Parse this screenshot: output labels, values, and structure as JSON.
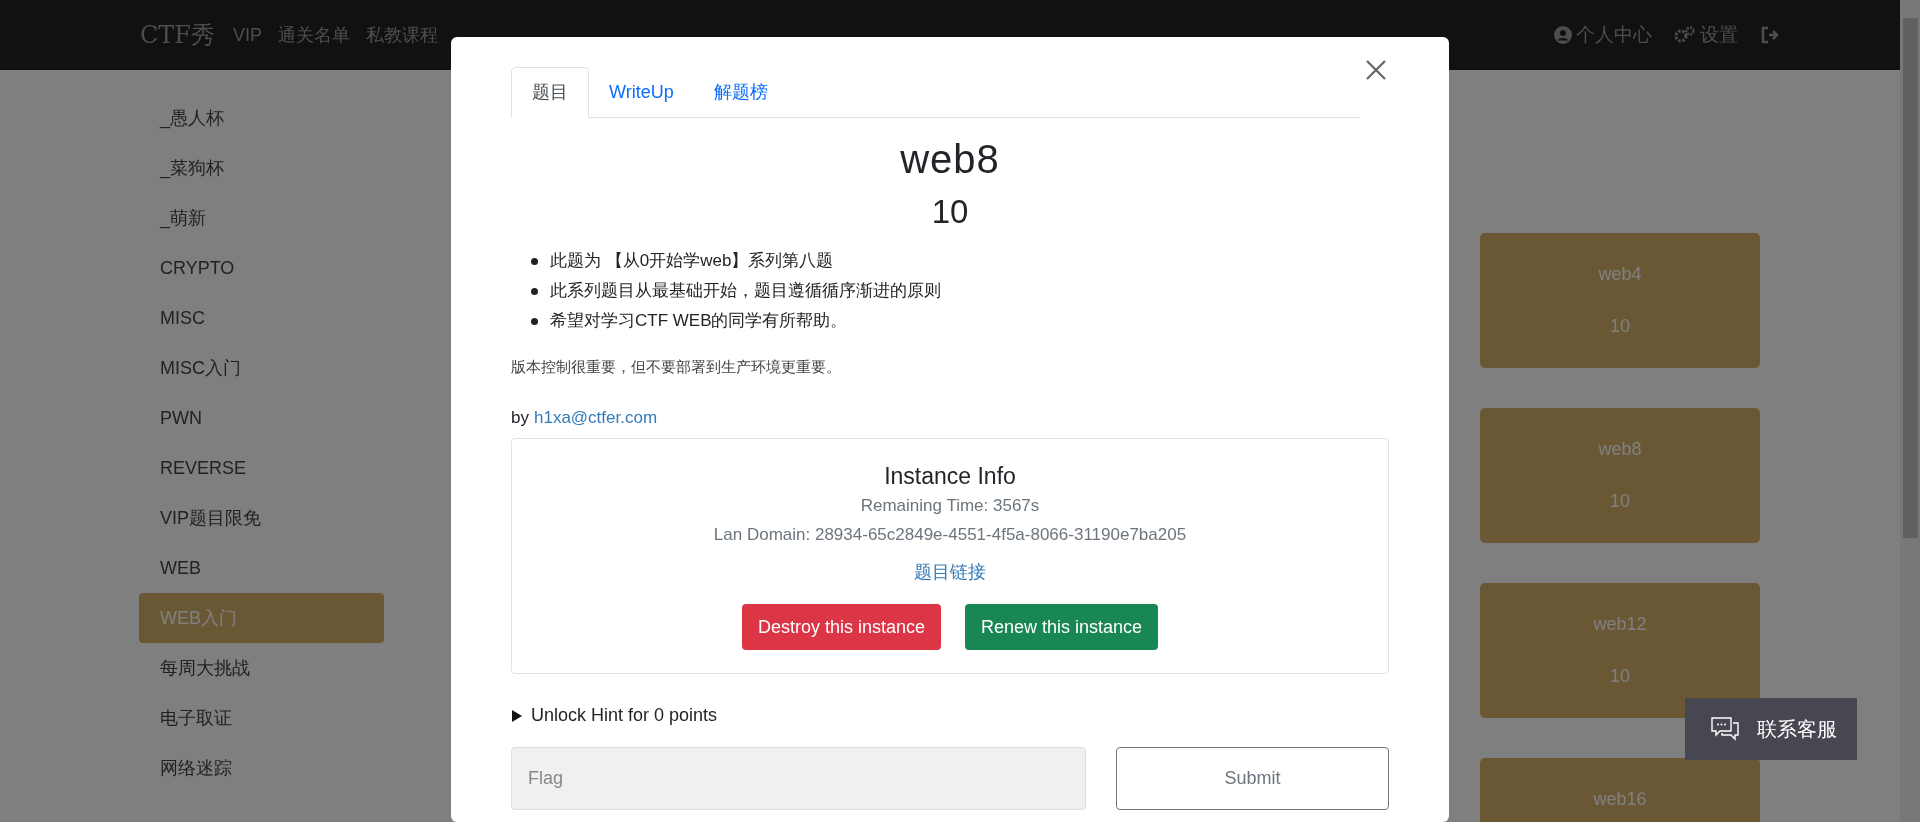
{
  "nav": {
    "logo": "CTF秀",
    "links": [
      "VIP",
      "通关名单",
      "私教课程"
    ],
    "user_menu": "个人中心",
    "settings": "设置"
  },
  "sidebar": {
    "items": [
      {
        "label": "_愚人杯",
        "selected": false
      },
      {
        "label": "_菜狗杯",
        "selected": false
      },
      {
        "label": "_萌新",
        "selected": false
      },
      {
        "label": "CRYPTO",
        "selected": false
      },
      {
        "label": "MISC",
        "selected": false
      },
      {
        "label": "MISC入门",
        "selected": false
      },
      {
        "label": "PWN",
        "selected": false
      },
      {
        "label": "REVERSE",
        "selected": false
      },
      {
        "label": "VIP题目限免",
        "selected": false
      },
      {
        "label": "WEB",
        "selected": false
      },
      {
        "label": "WEB入门",
        "selected": true
      },
      {
        "label": "每周大挑战",
        "selected": false
      },
      {
        "label": "电子取证",
        "selected": false
      },
      {
        "label": "网络迷踪",
        "selected": false
      }
    ]
  },
  "challenge_cards": [
    {
      "name": "web4",
      "points": "10"
    },
    {
      "name": "web8",
      "points": "10"
    },
    {
      "name": "web12",
      "points": "10"
    },
    {
      "name": "web16"
    }
  ],
  "modal": {
    "tabs": [
      {
        "label": "题目",
        "selected": true
      },
      {
        "label": "WriteUp",
        "selected": false
      },
      {
        "label": "解题榜",
        "selected": false
      }
    ],
    "title": "web8",
    "points": "10",
    "bullets": [
      "此题为 【从0开始学web】系列第八题",
      "此系列题目从最基础开始，题目遵循循序渐进的原则",
      "希望对学习CTF WEB的同学有所帮助。"
    ],
    "note": "版本控制很重要，但不要部署到生产环境更重要。",
    "author": {
      "prefix": "by",
      "email": "h1xa@ctfer.com"
    },
    "instance": {
      "heading": "Instance Info",
      "remaining_time": "Remaining Time: 3567s",
      "lan_domain": "Lan Domain: 28934-65c2849e-4551-4f5a-8066-31190e7ba205",
      "link": "题目链接",
      "buttons": [
        {
          "label": "Destroy this instance",
          "kind": "danger"
        },
        {
          "label": "Renew this instance",
          "kind": "success"
        }
      ]
    },
    "hint": {
      "label": "Unlock Hint for 0 points",
      "expanded": false
    },
    "flag_placeholder": "Flag",
    "submit": "Submit"
  },
  "contact_button": "联系客服"
}
